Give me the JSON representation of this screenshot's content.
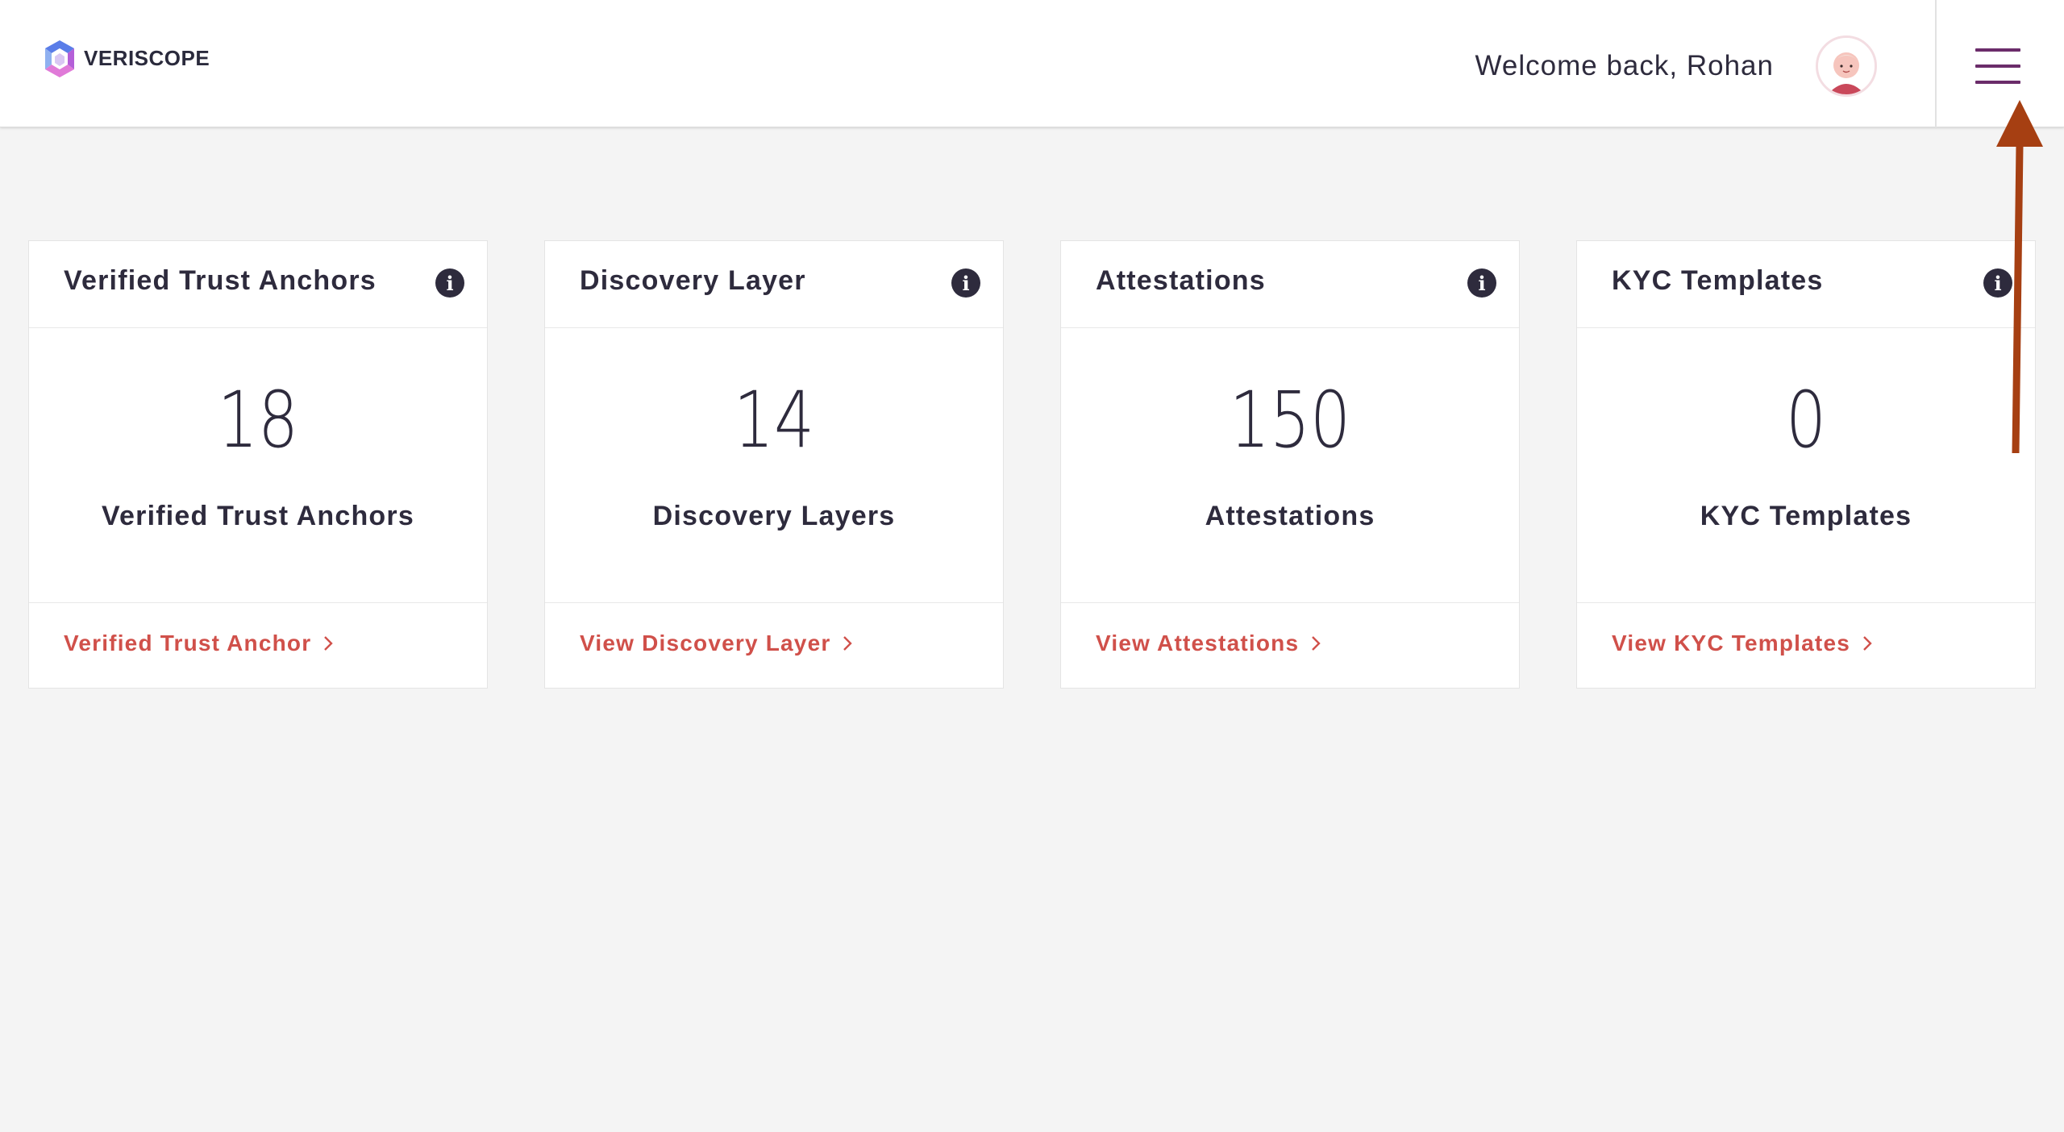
{
  "header": {
    "brand": "VERISCOPE",
    "welcome": "Welcome back, Rohan"
  },
  "colors": {
    "accent_link": "#d0504a",
    "menu": "#6b2c6a",
    "text": "#2e2b3d",
    "annotation_arrow": "#a63f12"
  },
  "cards": [
    {
      "title": "Verified Trust Anchors",
      "count": "18",
      "subtitle": "Verified Trust Anchors",
      "link": "Verified Trust Anchor"
    },
    {
      "title": "Discovery Layer",
      "count": "14",
      "subtitle": "Discovery Layers",
      "link": "View Discovery Layer"
    },
    {
      "title": "Attestations",
      "count": "150",
      "subtitle": "Attestations",
      "link": "View Attestations"
    },
    {
      "title": "KYC Templates",
      "count": "0",
      "subtitle": "KYC Templates",
      "link": "View KYC Templates"
    }
  ]
}
